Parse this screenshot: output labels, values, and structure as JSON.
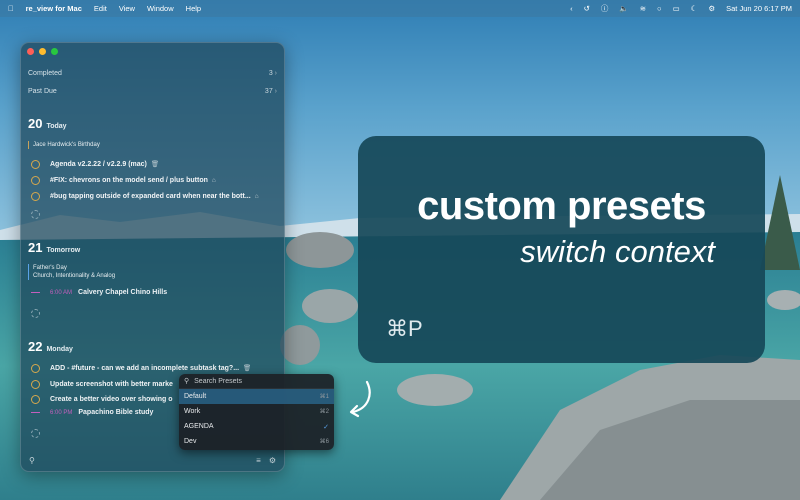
{
  "menubar": {
    "apple_icon": "apple-logo",
    "app_name": "re_view for Mac",
    "menus": [
      "Edit",
      "View",
      "Window",
      "Help"
    ],
    "clock": "Sat Jun 20  6:17 PM"
  },
  "sidebar": {
    "completed_label": "Completed",
    "completed_count": "3",
    "pastdue_label": "Past Due",
    "pastdue_count": "37"
  },
  "days": [
    {
      "num": "20",
      "name": "Today",
      "event": "Jace Hardwick's Birthday",
      "tasks": [
        "Agenda v2.2.22 / v2.2.9 (mac)",
        "#FIX: chevrons on the model send / plus button",
        "#bug tapping outside of expanded card when near the bott..."
      ]
    },
    {
      "num": "21",
      "name": "Tomorrow",
      "event_title": "Father's Day",
      "event_sub": "Church, Intentionality & Analog",
      "timed_time": "6:00 AM",
      "timed_title": "Calvery Chapel Chino Hills"
    },
    {
      "num": "22",
      "name": "Monday",
      "tasks": [
        "ADD - #future - can we add an incomplete subtask tag?...",
        "Update screenshot with better marke",
        "Create a better video over showing o"
      ],
      "timed_time": "6:00 PM",
      "timed_title": "Papachino Bible study"
    }
  ],
  "presets": {
    "search_placeholder": "Search Presets",
    "options": [
      {
        "label": "Default",
        "shortcut": "⌘1"
      },
      {
        "label": "Work",
        "shortcut": "⌘2"
      },
      {
        "label": "AGENDA",
        "shortcut": "✓"
      },
      {
        "label": "Dev",
        "shortcut": "⌘6"
      }
    ]
  },
  "promo": {
    "title": "custom presets",
    "subtitle": "switch context",
    "shortcut": "⌘P"
  },
  "colors": {
    "accent_task": "#d6a84d",
    "accent_event": "#c45fbd",
    "selected": "#285f82"
  }
}
